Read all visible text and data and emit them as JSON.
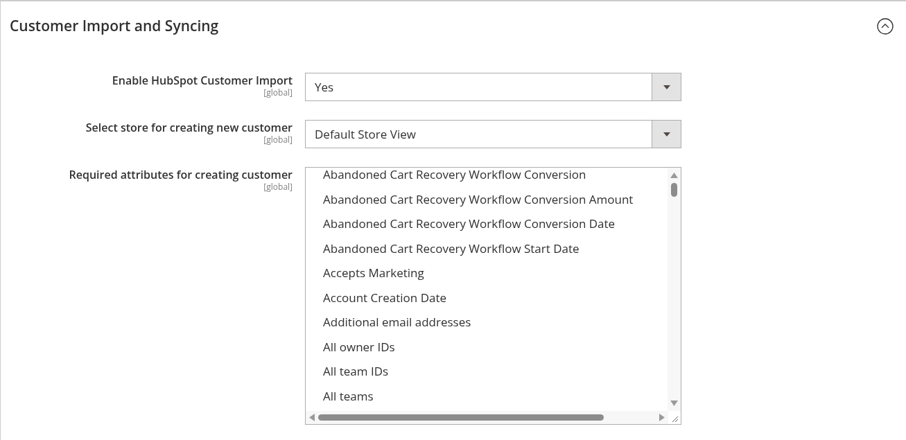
{
  "section": {
    "title": "Customer Import and Syncing",
    "expanded": true
  },
  "fields": [
    {
      "kind": "select",
      "label": "Enable HubSpot Customer Import",
      "scope": "[global]",
      "value": "Yes"
    },
    {
      "kind": "select",
      "label": "Select store for creating new customer",
      "scope": "[global]",
      "value": "Default Store View"
    },
    {
      "kind": "multiselect",
      "label": "Required attributes for creating customer",
      "scope": "[global]",
      "options": [
        {
          "label": "Abandoned Cart Recovery Workflow Conversion",
          "selected": false
        },
        {
          "label": "Abandoned Cart Recovery Workflow Conversion Amount",
          "selected": false
        },
        {
          "label": "Abandoned Cart Recovery Workflow Conversion Date",
          "selected": false
        },
        {
          "label": "Abandoned Cart Recovery Workflow Start Date",
          "selected": false
        },
        {
          "label": "Accepts Marketing",
          "selected": false
        },
        {
          "label": "Account Creation Date",
          "selected": false
        },
        {
          "label": "Additional email addresses",
          "selected": false
        },
        {
          "label": "All owner IDs",
          "selected": false
        },
        {
          "label": "All team IDs",
          "selected": false
        },
        {
          "label": "All teams",
          "selected": false
        }
      ]
    }
  ]
}
